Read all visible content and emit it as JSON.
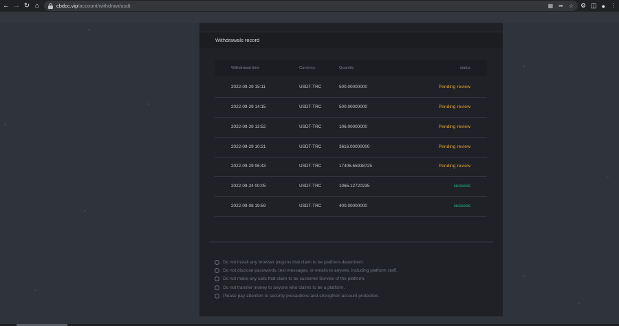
{
  "browser": {
    "url_domain": "cbdcc.vip",
    "url_path": "/account/withdraw/usdt",
    "icons": [
      "back-arrow-icon",
      "forward-arrow-icon",
      "reload-icon",
      "home-icon",
      "lock-icon",
      "translate-icon",
      "share-icon",
      "star-icon",
      "extensions-icon",
      "side-panel-icon",
      "profile-icon",
      "menu-icon"
    ]
  },
  "panel": {
    "title": "Withdrawals record"
  },
  "table": {
    "headers": {
      "time": "Withdrawal time",
      "currency": "Currency",
      "quantity": "Quantity",
      "status": "status"
    },
    "rows": [
      {
        "time": "2022-09-29 15:11",
        "currency": "USDT-TRC",
        "quantity": "500.00000000",
        "status": "Pending review",
        "state": "pending"
      },
      {
        "time": "2022-09-29 14:15",
        "currency": "USDT-TRC",
        "quantity": "500.00000000",
        "status": "Pending review",
        "state": "pending"
      },
      {
        "time": "2022-09-29 13:52",
        "currency": "USDT-TRC",
        "quantity": "106.00000000",
        "status": "Pending review",
        "state": "pending"
      },
      {
        "time": "2022-09-29 10:21",
        "currency": "USDT-TRC",
        "quantity": "3616.00000000",
        "status": "Pending review",
        "state": "pending"
      },
      {
        "time": "2022-09-29 06:43",
        "currency": "USDT-TRC",
        "quantity": "17406.65938725",
        "status": "Pending review",
        "state": "pending"
      },
      {
        "time": "2022-09-24 00:05",
        "currency": "USDT-TRC",
        "quantity": "1065.12720235",
        "status": "success",
        "state": "success"
      },
      {
        "time": "2022-09-08 19:59",
        "currency": "USDT-TRC",
        "quantity": "400.00000000",
        "status": "success",
        "state": "success"
      }
    ]
  },
  "tips": [
    "Do not install any browser plug-ins that claim to be platform-dependent.",
    "Do not disclose passwords, text messages, or emails to anyone, including platform staff.",
    "Do not make any calls that claim to be customer Service of the platform.",
    "Do not transfer money to anyone who claims to be a platform.",
    "Please pay attention to security precautions and strengthen account protection."
  ],
  "colors": {
    "pending": "#e0a32c",
    "success": "#1fbf84",
    "panel_bg": "#1f2126",
    "page_bg": "#2f333b"
  }
}
